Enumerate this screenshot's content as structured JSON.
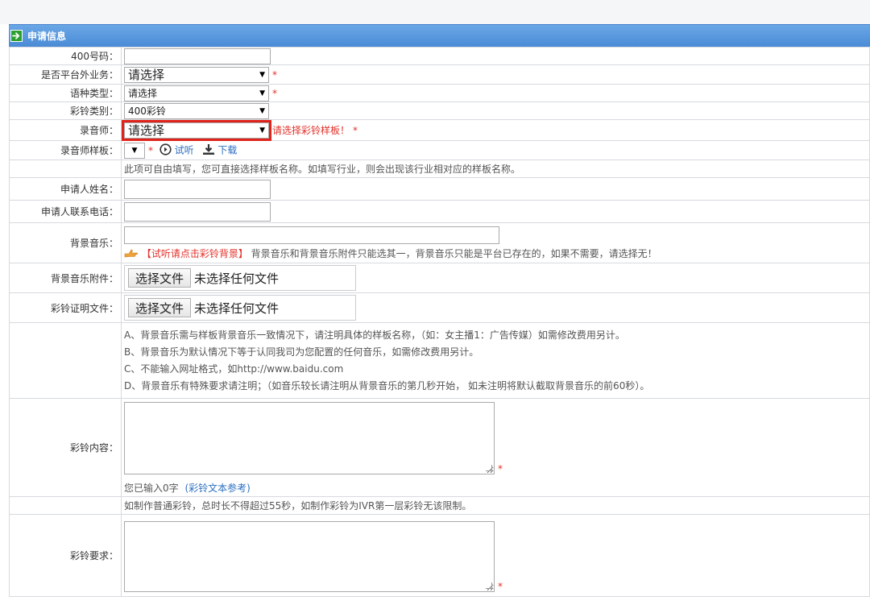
{
  "panel": {
    "title": "申请信息"
  },
  "labels": {
    "number_400": "400号码：",
    "off_platform": "是否平台外业务：",
    "language_type": "语种类型：",
    "ringtone_category": "彩铃类别：",
    "recorder": "录音师：",
    "recorder_template": "录音师样板：",
    "applicant_name": "申请人姓名：",
    "applicant_phone": "申请人联系电话：",
    "bg_music": "背景音乐：",
    "bg_music_attachment": "背景音乐附件：",
    "ringtone_proof": "彩铃证明文件：",
    "ringtone_content": "彩铃内容：",
    "ringtone_requirement": "彩铃要求："
  },
  "fields": {
    "number_400": {
      "value": ""
    },
    "off_platform": {
      "selected": "请选择"
    },
    "language_type": {
      "selected": "请选择"
    },
    "ringtone_category": {
      "selected": "400彩铃"
    },
    "recorder": {
      "selected": "请选择",
      "warning": "请选择彩铃样板！"
    },
    "recorder_template": {
      "selected": ""
    },
    "applicant_name": {
      "value": ""
    },
    "applicant_phone": {
      "value": ""
    },
    "bg_music": {
      "value": ""
    },
    "ringtone_content": {
      "value": ""
    },
    "ringtone_requirement": {
      "value": ""
    }
  },
  "required_mark": "*",
  "actions": {
    "audition": "试听",
    "download": "下载"
  },
  "template_hint": "此项可自由填写，您可直接选择样板名称。如填写行业，则会出现该行业相对应的样板名称。",
  "bg_music_hint": {
    "link": "【试听请点击彩铃背景】",
    "text": "背景音乐和背景音乐附件只能选其一，背景音乐只能是平台已存在的，如果不需要，请选择无！"
  },
  "file_inputs": {
    "button": "选择文件",
    "status": "未选择任何文件"
  },
  "bg_notes": [
    "A、背景音乐需与样板背景音乐一致情况下，请注明具体的样板名称，（如：女主播1：广告传媒）如需修改费用另计。",
    "B、背景音乐为默认情况下等于认同我司为您配置的任何音乐，如需修改费用另计。",
    "C、不能输入网址格式，如http://www.baidu.com",
    "D、背景音乐有特殊要求请注明；（如音乐较长请注明从背景音乐的第几秒开始， 如未注明将默认截取背景音乐的前60秒）。"
  ],
  "content_counter": {
    "text": "您已输入0字",
    "link": "(彩铃文本参考)"
  },
  "duration_note": "如制作普通彩铃，总时长不得超过55秒，如制作彩铃为IVR第一层彩铃无该限制。",
  "colors": {
    "header": "#4a8bd6",
    "required": "#e2322b",
    "link": "#2d6fc0",
    "highlight": "#e0221b"
  },
  "icons": [
    "arrow-right-icon",
    "play-circle-icon",
    "download-icon",
    "hand-pointer-icon"
  ]
}
